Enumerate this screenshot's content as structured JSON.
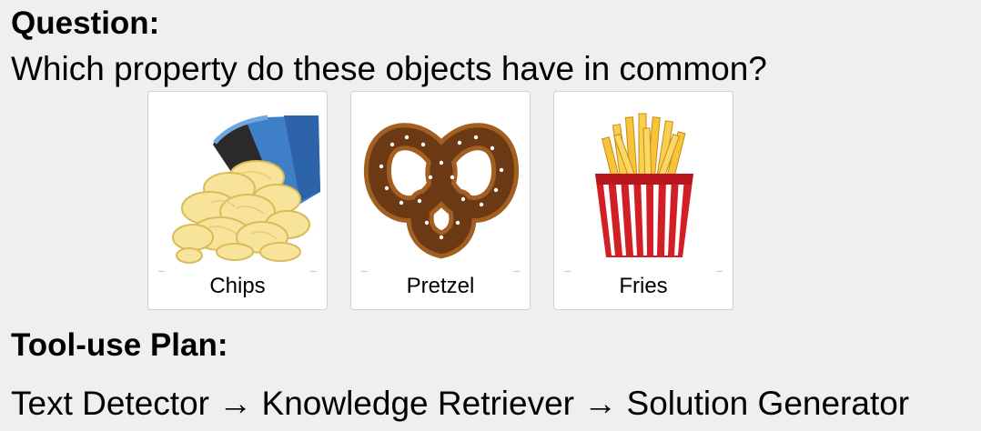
{
  "question": {
    "heading": "Question:",
    "text": "Which property do these objects have in common?"
  },
  "options": [
    {
      "label": "Chips",
      "icon": "chips-image"
    },
    {
      "label": "Pretzel",
      "icon": "pretzel-image"
    },
    {
      "label": "Fries",
      "icon": "fries-image"
    }
  ],
  "plan": {
    "heading": "Tool-use Plan:",
    "text": "Text Detector → Knowledge Retriever → Solution Generator"
  }
}
